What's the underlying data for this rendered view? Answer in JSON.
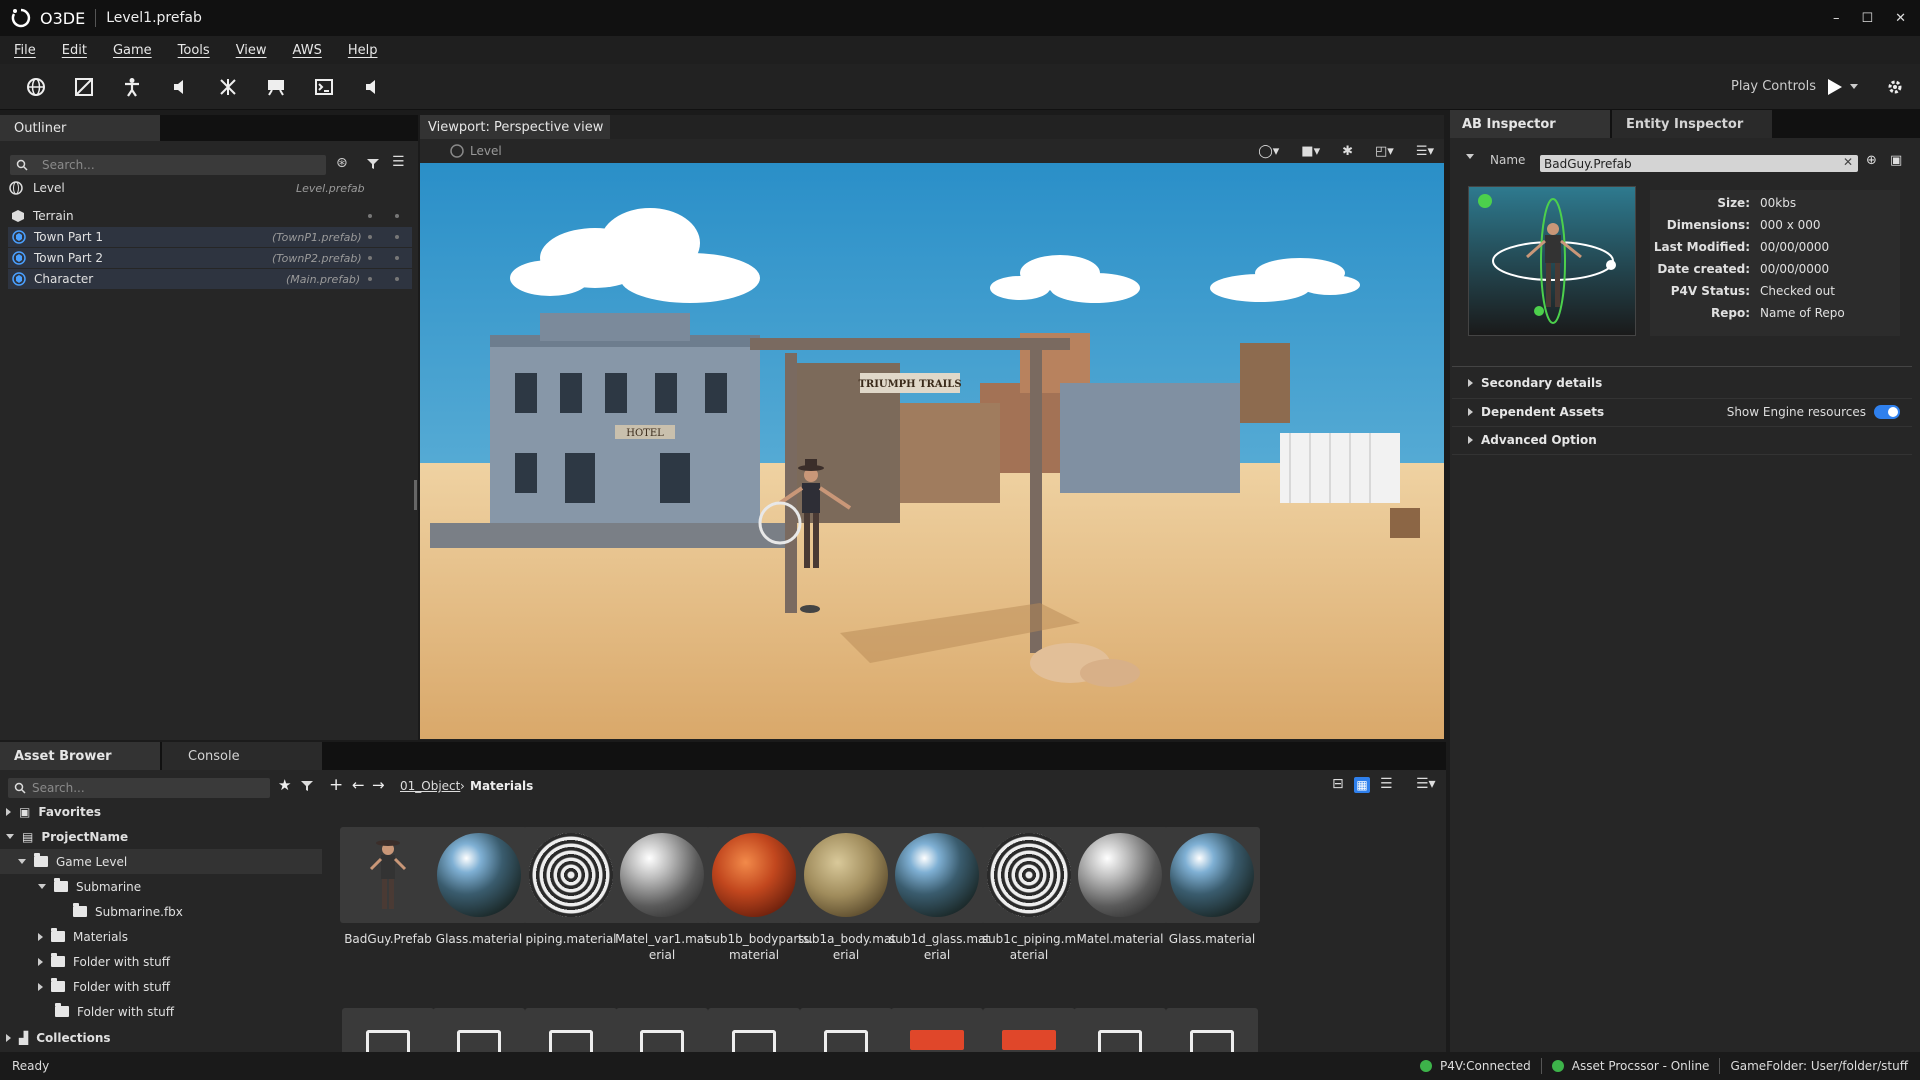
{
  "app": {
    "name": "O3DE",
    "document": "Level1.prefab"
  },
  "window_controls": {
    "minimize": "–",
    "maximize": "☐",
    "close": "✕"
  },
  "menu": [
    "File",
    "Edit",
    "Game",
    "Tools",
    "View",
    "AWS",
    "Help"
  ],
  "toolbar": {
    "icons": [
      "globe-icon",
      "gradient-icon",
      "character-icon",
      "audio-icon",
      "particles-icon",
      "track-view-icon",
      "console-icon",
      "audio-controls-icon"
    ],
    "play_controls_label": "Play Controls"
  },
  "outliner": {
    "tab": "Outliner",
    "search_placeholder": "Search...",
    "root": {
      "label": "Level",
      "file": "Level.prefab"
    },
    "items": [
      {
        "label": "Terrain",
        "file": ""
      },
      {
        "label": "Town Part 1",
        "file": "(TownP1.prefab)"
      },
      {
        "label": "Town Part 2",
        "file": "(TownP2.prefab)"
      },
      {
        "label": "Character",
        "file": "(Main.prefab)"
      }
    ]
  },
  "viewport": {
    "tab": "Viewport: Perspective view",
    "breadcrumb": "Level",
    "signs": {
      "hotel": "HOTEL",
      "trails": "TRIUMPH TRAILS"
    }
  },
  "inspector": {
    "tabs": [
      "AB Inspector",
      "Entity Inspector"
    ],
    "name_label": "Name",
    "name_value": "BadGuy.Prefab",
    "properties": [
      {
        "key": "Size:",
        "value": "00kbs"
      },
      {
        "key": "Dimensions:",
        "value": "000 x 000"
      },
      {
        "key": "Last Modified:",
        "value": "00/00/0000"
      },
      {
        "key": "Date created:",
        "value": "00/00/0000"
      },
      {
        "key": "P4V Status:",
        "value": "Checked out"
      },
      {
        "key": "Repo:",
        "value": "Name of Repo"
      }
    ],
    "sections": [
      "Secondary details",
      "Dependent Assets",
      "Advanced Option"
    ],
    "show_engine_resources_label": "Show Engine resources",
    "show_engine_resources": true
  },
  "asset_browser": {
    "tabs": [
      "Asset Brower",
      "Console"
    ],
    "search_placeholder": "Search...",
    "breadcrumb": [
      "01_Object",
      "Materials"
    ],
    "tree": [
      {
        "label": "Favorites",
        "expanded": false
      },
      {
        "label": "ProjectName",
        "expanded": true
      },
      {
        "label": "Game Level",
        "expanded": true
      },
      {
        "label": "Submarine",
        "expanded": true
      },
      {
        "label": "Submarine.fbx",
        "expanded": false
      },
      {
        "label": "Materials",
        "expanded": false
      },
      {
        "label": "Folder with stuff",
        "expanded": false
      },
      {
        "label": "Folder with stuff",
        "expanded": false
      },
      {
        "label": "Folder with stuff",
        "expanded": false
      },
      {
        "label": "Collections",
        "expanded": false
      }
    ],
    "assets": [
      {
        "name": "BadGuy.Prefab",
        "name2": "",
        "kind": "prefab"
      },
      {
        "name": "Glass.material",
        "name2": "",
        "kind": "glass"
      },
      {
        "name": "piping.material",
        "name2": "",
        "kind": "piping"
      },
      {
        "name": "Matel_var1.mat",
        "name2": "erial",
        "kind": "metal"
      },
      {
        "name": "sub1b_bodyparts.",
        "name2": "material",
        "kind": "rust"
      },
      {
        "name": "sub1a_body.mat",
        "name2": "erial",
        "kind": "stone"
      },
      {
        "name": "sub1d_glass.mat",
        "name2": "erial",
        "kind": "glass"
      },
      {
        "name": "sub1c_piping.m",
        "name2": "aterial",
        "kind": "piping"
      },
      {
        "name": "Matel.material",
        "name2": "",
        "kind": "metal"
      },
      {
        "name": "Glass.material",
        "name2": "",
        "kind": "glass"
      }
    ]
  },
  "status": {
    "left": "Ready",
    "p4v": "P4V:Connected",
    "processor": "Asset Procssor - Online",
    "folder": "GameFolder: User/folder/stuff"
  },
  "colors": {
    "accent": "#2f80ed",
    "ok": "#3db34a",
    "sky": "#3aa6d6",
    "sand": "#e8c79a"
  }
}
